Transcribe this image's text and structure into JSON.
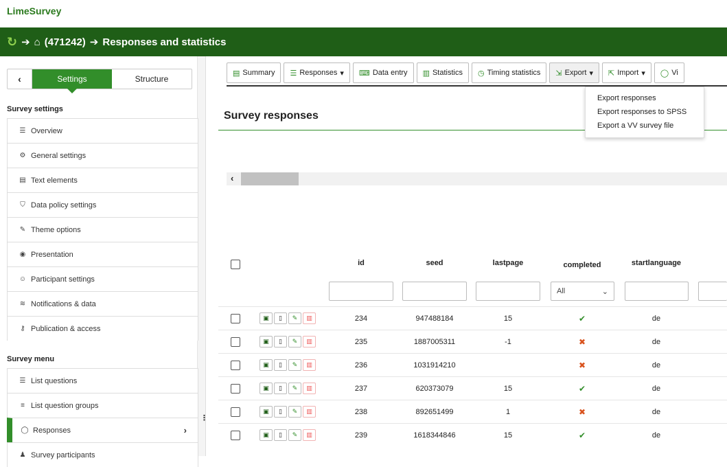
{
  "app": {
    "brand": "LimeSurvey"
  },
  "header": {
    "survey_id": "(471242)",
    "page": "Responses and statistics"
  },
  "sidebar": {
    "tabs": {
      "settings": "Settings",
      "structure": "Structure"
    },
    "survey_settings_title": "Survey settings",
    "settings_items": [
      {
        "label": "Overview",
        "icon": "list-icon"
      },
      {
        "label": "General settings",
        "icon": "gears-icon"
      },
      {
        "label": "Text elements",
        "icon": "file-text-icon"
      },
      {
        "label": "Data policy settings",
        "icon": "shield-icon"
      },
      {
        "label": "Theme options",
        "icon": "brush-icon"
      },
      {
        "label": "Presentation",
        "icon": "eye-slash-icon"
      },
      {
        "label": "Participant settings",
        "icon": "users-icon"
      },
      {
        "label": "Notifications & data",
        "icon": "rss-icon"
      },
      {
        "label": "Publication & access",
        "icon": "key-icon"
      }
    ],
    "survey_menu_title": "Survey menu",
    "menu_items": [
      {
        "label": "List questions",
        "icon": "list-icon"
      },
      {
        "label": "List question groups",
        "icon": "list-ul-icon"
      },
      {
        "label": "Responses",
        "icon": "comment-icon"
      },
      {
        "label": "Survey participants",
        "icon": "user-icon"
      }
    ]
  },
  "toolbar": {
    "summary": "Summary",
    "responses": "Responses",
    "data_entry": "Data entry",
    "statistics": "Statistics",
    "timing": "Timing statistics",
    "export": "Export",
    "import": "Import",
    "view": "Vi"
  },
  "export_menu": [
    "Export responses",
    "Export responses to SPSS",
    "Export a VV survey file"
  ],
  "main": {
    "title": "Survey responses"
  },
  "table": {
    "columns": {
      "id": "id",
      "seed": "seed",
      "lastpage": "lastpage",
      "completed": "completed",
      "startlanguage": "startlanguage"
    },
    "completed_filter": "All",
    "rows": [
      {
        "id": "234",
        "seed": "947488184",
        "lastpage": "15",
        "completed": true,
        "lang": "de"
      },
      {
        "id": "235",
        "seed": "1887005311",
        "lastpage": "-1",
        "completed": false,
        "lang": "de"
      },
      {
        "id": "236",
        "seed": "1031914210",
        "lastpage": "",
        "completed": false,
        "lang": "de"
      },
      {
        "id": "237",
        "seed": "620373079",
        "lastpage": "15",
        "completed": true,
        "lang": "de"
      },
      {
        "id": "238",
        "seed": "892651499",
        "lastpage": "1",
        "completed": false,
        "lang": "de"
      },
      {
        "id": "239",
        "seed": "1618344846",
        "lastpage": "15",
        "completed": true,
        "lang": "de"
      }
    ]
  }
}
